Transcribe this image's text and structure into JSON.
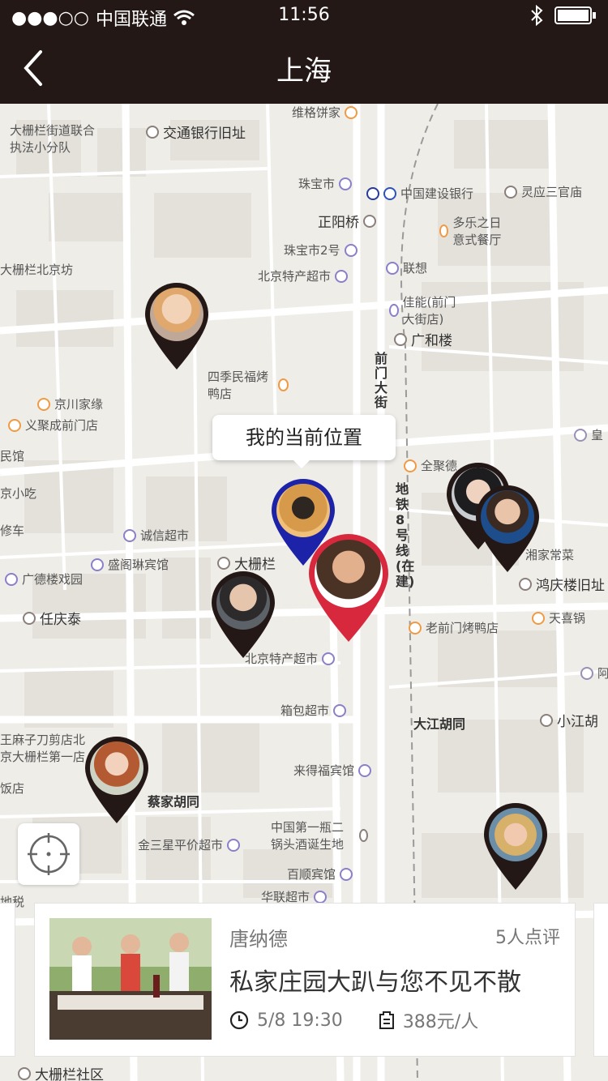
{
  "status_bar": {
    "carrier": "中国联通",
    "time": "11:56",
    "signal": "●●●○○"
  },
  "nav": {
    "title": "上海"
  },
  "map": {
    "pois": [
      {
        "name": "维格饼家",
        "type": "food"
      },
      {
        "name": "交通银行旧址",
        "type": "bank"
      },
      {
        "name": "大栅栏街道联合执法小分队",
        "type": "label"
      },
      {
        "name": "珠宝市",
        "type": "shop"
      },
      {
        "name": "中国建设银行",
        "type": "bank"
      },
      {
        "name": "灵应三官庙",
        "type": "bank"
      },
      {
        "name": "正阳桥",
        "type": "bank"
      },
      {
        "name": "多乐之日意式餐厅",
        "type": "food"
      },
      {
        "name": "珠宝市2号",
        "type": "shop"
      },
      {
        "name": "联想",
        "type": "shop"
      },
      {
        "name": "大栅栏北京坊",
        "type": "label"
      },
      {
        "name": "北京特产超市",
        "type": "shop"
      },
      {
        "name": "佳能(前门大街店)",
        "type": "shop"
      },
      {
        "name": "广和楼",
        "type": "bank"
      },
      {
        "name": "四季民福烤鸭店",
        "type": "food"
      },
      {
        "name": "京川家缘",
        "type": "food"
      },
      {
        "name": "义聚成前门店",
        "type": "food"
      },
      {
        "name": "全聚德",
        "type": "food"
      },
      {
        "name": "诚信超市",
        "type": "shop"
      },
      {
        "name": "盛阁琳宾馆",
        "type": "shop"
      },
      {
        "name": "大栅栏",
        "type": "bank"
      },
      {
        "name": "广德楼戏园",
        "type": "shop"
      },
      {
        "name": "任庆泰",
        "type": "bank"
      },
      {
        "name": "北京特产超市",
        "type": "shop"
      },
      {
        "name": "湘家常菜",
        "type": "label"
      },
      {
        "name": "鸿庆楼旧址",
        "type": "bank"
      },
      {
        "name": "天喜锅",
        "type": "food"
      },
      {
        "name": "老前门烤鸭店",
        "type": "food"
      },
      {
        "name": "箱包超市",
        "type": "shop"
      },
      {
        "name": "大江胡同",
        "type": "street"
      },
      {
        "name": "小江胡",
        "type": "bank"
      },
      {
        "name": "王麻子刀剪店北京大栅栏第一店",
        "type": "label"
      },
      {
        "name": "来得福宾馆",
        "type": "shop"
      },
      {
        "name": "蔡家胡同",
        "type": "street"
      },
      {
        "name": "中国第一瓶二锅头酒诞生地",
        "type": "label"
      },
      {
        "name": "金三星平价超市",
        "type": "shop"
      },
      {
        "name": "百顺宾馆",
        "type": "shop"
      },
      {
        "name": "华联超市",
        "type": "shop"
      },
      {
        "name": "大栅栏社区",
        "type": "bank"
      },
      {
        "name": "前门大街",
        "type": "street"
      },
      {
        "name": "地铁8号线(在建)",
        "type": "street"
      },
      {
        "name": "阿",
        "type": "label"
      },
      {
        "name": "皇",
        "type": "label"
      },
      {
        "name": "京小吃",
        "type": "label"
      },
      {
        "name": "修车",
        "type": "label"
      },
      {
        "name": "饭店",
        "type": "label"
      },
      {
        "name": "地税",
        "type": "label"
      },
      {
        "name": "民馆",
        "type": "label"
      }
    ],
    "current_location_label": "我的当前位置"
  },
  "event_card": {
    "host": "唐纳德",
    "reviews": "5人点评",
    "title": "私家庄园大趴与您不见不散",
    "datetime": "5/8 19:30",
    "price": "388元/人"
  },
  "colors": {
    "bar_bg": "#231815",
    "pin_dark": "#231815",
    "pin_blue": "#1d23a8",
    "pin_red": "#d8283e"
  }
}
